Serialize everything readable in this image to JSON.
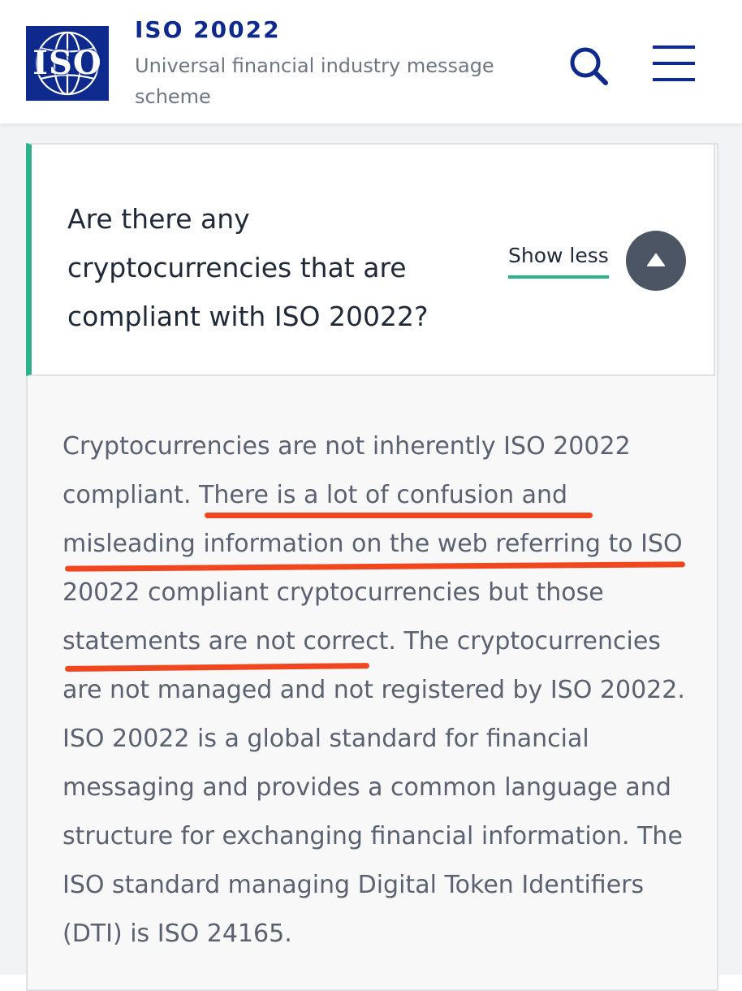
{
  "header": {
    "logo_text": "ISO",
    "title": "ISO 20022",
    "subtitle": "Universal financial industry message scheme",
    "icons": {
      "search": "search-icon",
      "menu": "hamburger-menu-icon"
    },
    "brand_color": "#0e2a8c"
  },
  "faq": {
    "question": "Are there any cryptocurrencies that are compliant with ISO 20022?",
    "toggle_label": "Show less",
    "toggle_icon": "triangle-up-icon",
    "accent_color": "#2db28a",
    "answer": "Cryptocurrencies are not inherently ISO 20022 compliant. There is a lot of confusion and misleading information on the web referring to ISO 20022 compliant cryptocurrencies but those statements are not correct. The cryptocurrencies are not managed and not registered by ISO 20022. ISO 20022 is a global standard for financial messaging and provides a common language and structure for exchanging financial information. The ISO standard managing Digital Token Identifiers (DTI) is ISO 24165.",
    "highlight_color": "#f0471e"
  }
}
